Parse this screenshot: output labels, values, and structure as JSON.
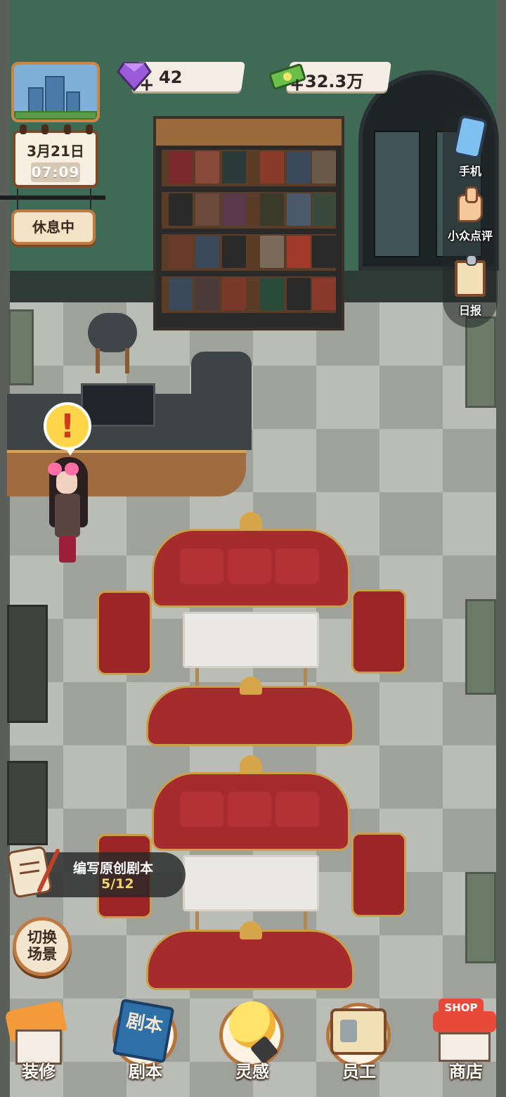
{
  "hud": {
    "gems": "42",
    "money": "32.3万",
    "plus": "+",
    "date": "3月21日",
    "time": "07:09",
    "status": "休息中"
  },
  "side_menu": [
    {
      "label": "手机",
      "icon": "phone-icon"
    },
    {
      "label": "小众点评",
      "icon": "thumbs-up-icon"
    },
    {
      "label": "日报",
      "icon": "report-clipboard-icon"
    }
  ],
  "alert": {
    "mark": "!"
  },
  "task": {
    "title": "编写原创剧本",
    "progress": "5/12"
  },
  "switch_scene": {
    "line1": "切换",
    "line2": "场景"
  },
  "bottom_nav": [
    {
      "label": "装修",
      "icon": "house-renovate-icon"
    },
    {
      "label": "剧本",
      "icon": "script-book-icon",
      "icon_text": "剧本"
    },
    {
      "label": "灵感",
      "icon": "lightbulb-icon"
    },
    {
      "label": "员工",
      "icon": "staff-badge-icon"
    },
    {
      "label": "商店",
      "icon": "shop-icon",
      "icon_text": "SHOP"
    }
  ],
  "colors": {
    "wall": "#3f6a55",
    "sofa": "#a62b2d",
    "trim": "#c8a04a",
    "hud_frame": "#c07a44",
    "task_progress": "#f2d36a"
  }
}
